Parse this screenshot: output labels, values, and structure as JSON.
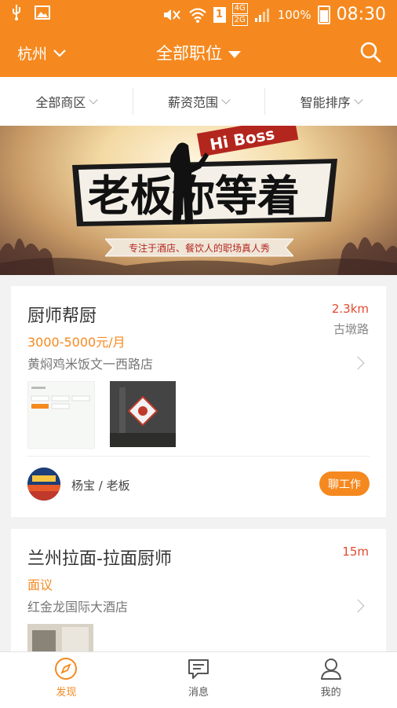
{
  "status_bar": {
    "battery": "100%",
    "time": "08:30",
    "network_labels": [
      "4G",
      "2G"
    ]
  },
  "header": {
    "city": "杭州",
    "title": "全部职位"
  },
  "filters": [
    {
      "label": "全部商区"
    },
    {
      "label": "薪资范围"
    },
    {
      "label": "智能排序"
    }
  ],
  "banner": {
    "title": "老板你等着",
    "tag": "Hi Boss",
    "slogan": "专注于酒店、餐饮人的职场真人秀"
  },
  "jobs": [
    {
      "title": "厨师帮厨",
      "distance": "2.3km",
      "area": "古墩路",
      "salary": "3000-5000元/月",
      "company": "黄焖鸡米饭文一西路店",
      "boss": "杨宝 / 老板",
      "chat_label": "聊工作"
    },
    {
      "title": "兰州拉面-拉面厨师",
      "distance": "15m",
      "salary": "面议",
      "company": "红金龙国际大酒店"
    }
  ],
  "tabs": [
    {
      "label": "发现",
      "icon": "compass-icon",
      "active": true
    },
    {
      "label": "消息",
      "icon": "message-icon",
      "active": false
    },
    {
      "label": "我的",
      "icon": "person-icon",
      "active": false
    }
  ],
  "colors": {
    "primary": "#f5891f",
    "distance": "#e04a2f"
  }
}
